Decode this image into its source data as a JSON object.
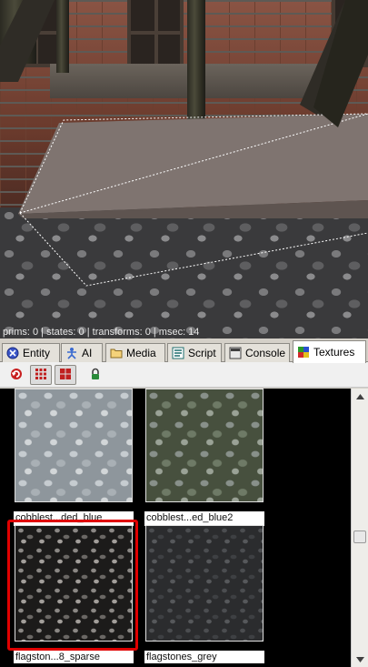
{
  "viewport": {
    "stats": "prims: 0 | states: 0 | transforms: 0 | msec: 14"
  },
  "tabs": [
    {
      "label": "Entity",
      "icon": "entity-icon",
      "active": false
    },
    {
      "label": "AI",
      "icon": "ai-icon",
      "active": false
    },
    {
      "label": "Media",
      "icon": "folder-icon",
      "active": false
    },
    {
      "label": "Script",
      "icon": "script-icon",
      "active": false
    },
    {
      "label": "Console",
      "icon": "console-icon",
      "active": false
    },
    {
      "label": "Textures",
      "icon": "textures-icon",
      "active": true
    }
  ],
  "toolbar": {
    "buttons": [
      {
        "icon": "refresh-icon",
        "pressed": false
      },
      {
        "icon": "small-grid-icon",
        "pressed": true
      },
      {
        "icon": "large-grid-icon",
        "pressed": true
      },
      {
        "icon": "lock-icon",
        "pressed": false
      }
    ]
  },
  "textures": [
    {
      "label": "cobblest...ded_blue",
      "selected": false
    },
    {
      "label": "cobblest...ed_blue2",
      "selected": false
    },
    {
      "label": "flagston...8_sparse",
      "selected": true
    },
    {
      "label": "flagstones_grey",
      "selected": false
    }
  ],
  "colors": {
    "selection": "#e00000",
    "grid_background": "#000000",
    "active_tab": "#ffffff"
  }
}
